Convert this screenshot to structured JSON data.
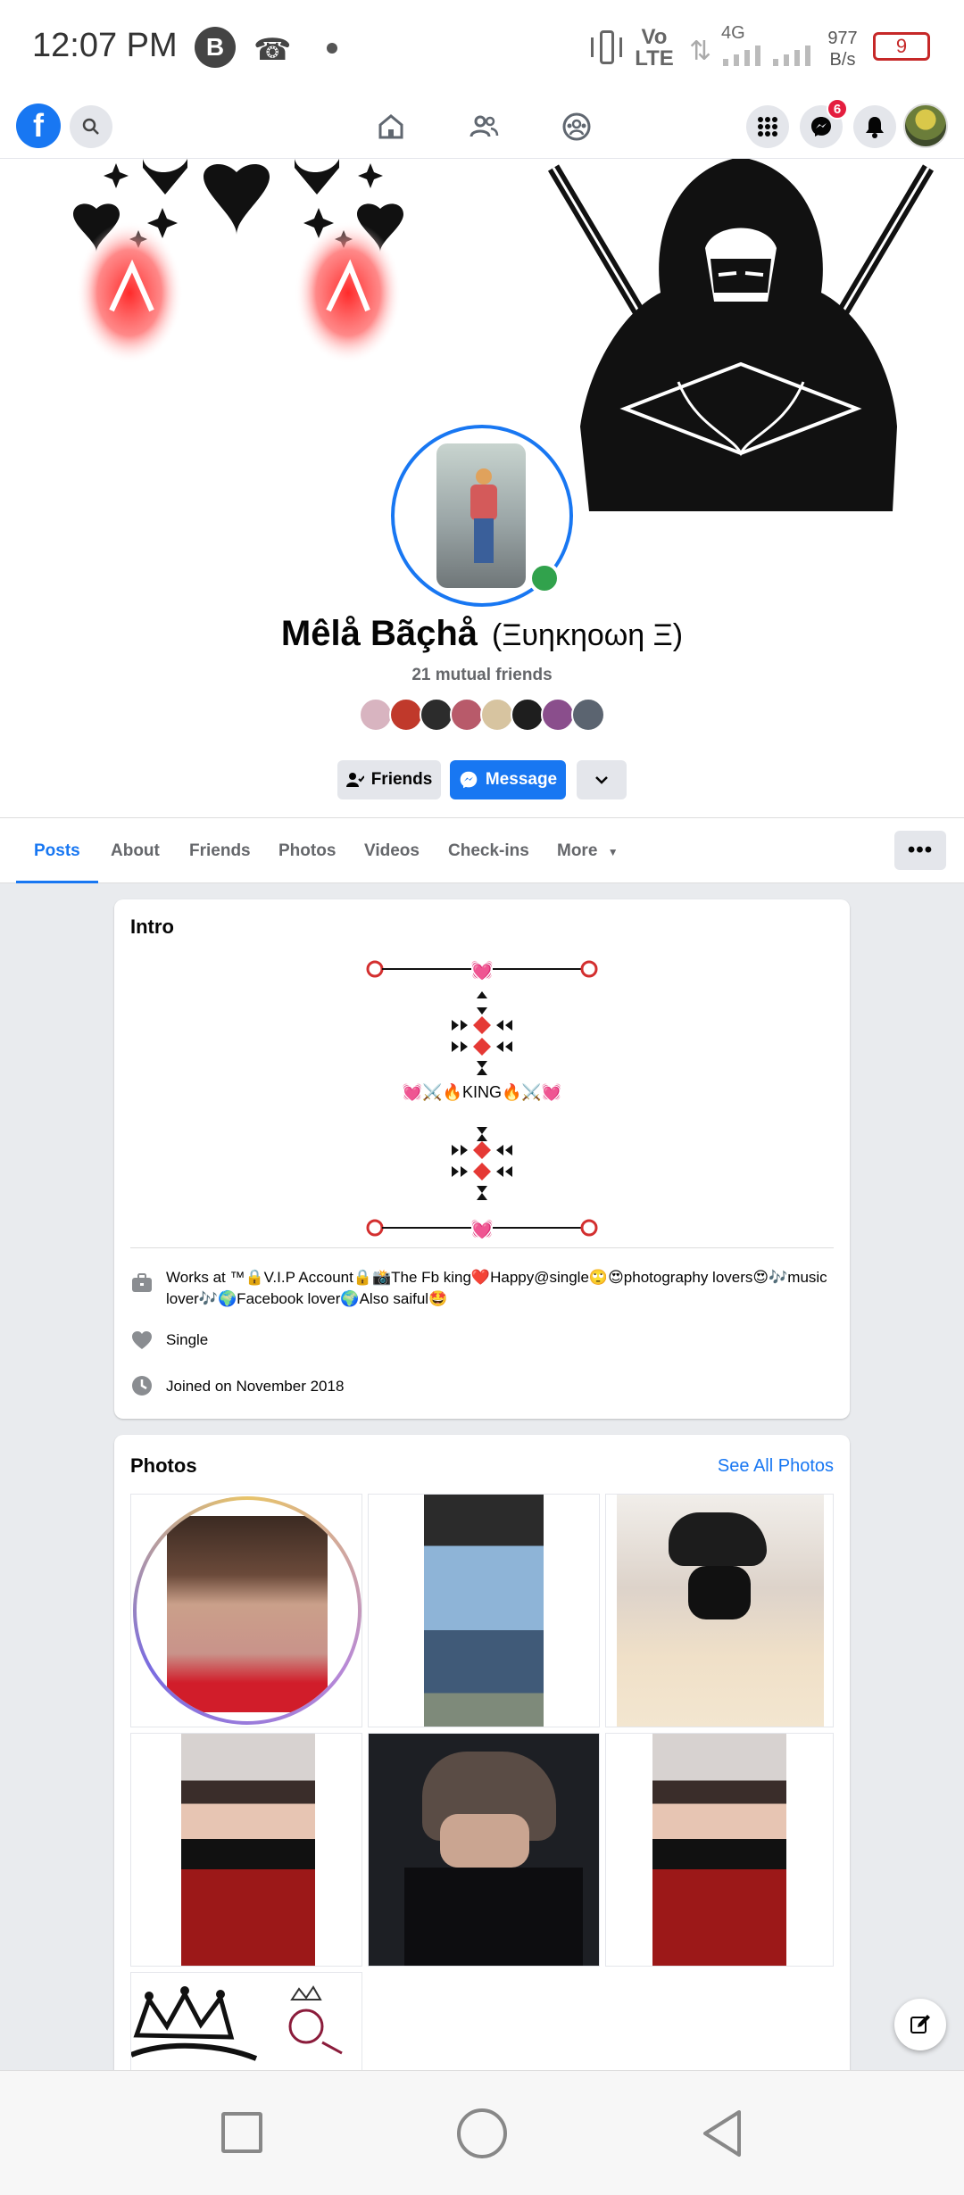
{
  "status_bar": {
    "time": "12:07 PM",
    "network_volte": "Vo\nLTE",
    "network_4g": "4G",
    "speed_value": "977",
    "speed_unit": "B/s",
    "battery": "9"
  },
  "top_nav": {
    "messenger_badge": "6"
  },
  "profile": {
    "name": "Mêlå Bãçhå",
    "nickname": "(Ξυηκηοωη Ξ)",
    "mutual_friends": "21 mutual friends",
    "friends_button": "Friends",
    "message_button": "Message"
  },
  "tabs": [
    {
      "label": "Posts"
    },
    {
      "label": "About"
    },
    {
      "label": "Friends"
    },
    {
      "label": "Photos"
    },
    {
      "label": "Videos"
    },
    {
      "label": "Check-ins"
    },
    {
      "label": "More"
    }
  ],
  "intro": {
    "title": "Intro",
    "bio_middle": "💓⚔️🔥KING🔥⚔️💓",
    "work_text": "Works at ™🔒V.I.P Account🔒📸The Fb king❤️Happy@single🙄😍photography lovers😍🎶music lover🎶🌍Facebook lover🌍Also saiful🤩",
    "relationship": "Single",
    "joined": "Joined on November 2018"
  },
  "photos": {
    "title": "Photos",
    "see_all": "See All Photos"
  },
  "colors": {
    "accent": "#1877f2",
    "online": "#31a24c",
    "badge": "#e41e3f"
  }
}
